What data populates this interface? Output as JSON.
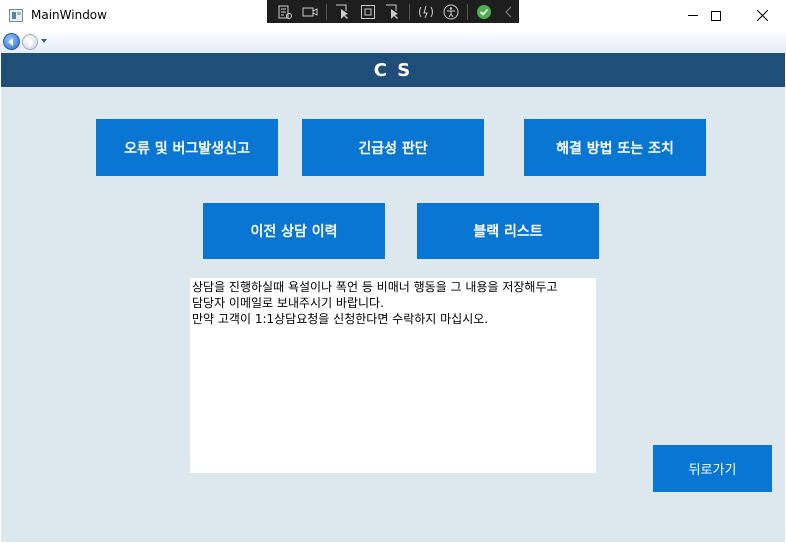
{
  "window": {
    "title": "MainWindow"
  },
  "debug_toolbar": {
    "icons": [
      "live-visual-tree-icon",
      "record-icon",
      "select-element-icon",
      "display-layout-adorners-icon",
      "track-focused-element-icon",
      "hot-reload-icon",
      "accessibility-icon",
      "hot-reload-status-icon",
      "collapse-icon"
    ]
  },
  "header": {
    "title": "C S"
  },
  "buttons": {
    "error_report": "오류 및 버그발생신고",
    "urgency": "긴급성 판단",
    "solution": "해결 방법 또는 조치",
    "history": "이전 상담 이력",
    "blacklist": "블랙 리스트",
    "back": "뒤로가기"
  },
  "notice": {
    "line1": "상담을 진행하실때 욕설이나 폭언 등 비매너 행동을 그 내용을 저장해두고",
    "line2": "담당자 이메일로 보내주시기 바랍니다.",
    "line3": "만약 고객이 1:1상담요청을 신청한다면 수락하지 마십시오."
  },
  "colors": {
    "header_bg": "#1f4e79",
    "content_bg": "#dde7ee",
    "button_bg": "#0a76d3",
    "button_text": "#ffffff"
  }
}
